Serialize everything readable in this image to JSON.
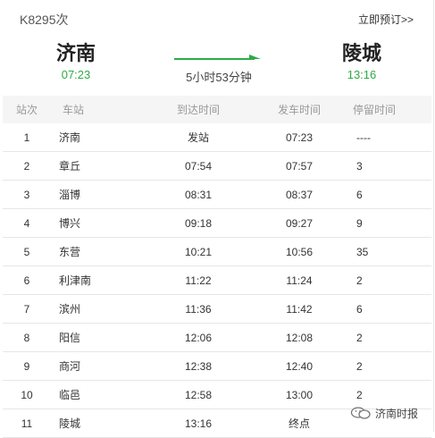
{
  "header": {
    "train_no": "K8295次",
    "book_link": "立即预订>>",
    "from_station": "济南",
    "from_time": "07:23",
    "to_station": "陵城",
    "to_time": "13:16",
    "duration": "5小时53分钟"
  },
  "table": {
    "columns": [
      "站次",
      "车站",
      "到达时间",
      "发车时间",
      "停留时间"
    ],
    "rows": [
      {
        "no": "1",
        "station": "济南",
        "arrive": "发站",
        "depart": "07:23",
        "stop": "----"
      },
      {
        "no": "2",
        "station": "章丘",
        "arrive": "07:54",
        "depart": "07:57",
        "stop": "3"
      },
      {
        "no": "3",
        "station": "淄博",
        "arrive": "08:31",
        "depart": "08:37",
        "stop": "6"
      },
      {
        "no": "4",
        "station": "博兴",
        "arrive": "09:18",
        "depart": "09:27",
        "stop": "9"
      },
      {
        "no": "5",
        "station": "东营",
        "arrive": "10:21",
        "depart": "10:56",
        "stop": "35"
      },
      {
        "no": "6",
        "station": "利津南",
        "arrive": "11:22",
        "depart": "11:24",
        "stop": "2"
      },
      {
        "no": "7",
        "station": "滨州",
        "arrive": "11:36",
        "depart": "11:42",
        "stop": "6"
      },
      {
        "no": "8",
        "station": "阳信",
        "arrive": "12:06",
        "depart": "12:08",
        "stop": "2"
      },
      {
        "no": "9",
        "station": "商河",
        "arrive": "12:38",
        "depart": "12:40",
        "stop": "2"
      },
      {
        "no": "10",
        "station": "临邑",
        "arrive": "12:58",
        "depart": "13:00",
        "stop": "2"
      },
      {
        "no": "11",
        "station": "陵城",
        "arrive": "13:16",
        "depart": "终点",
        "stop": ""
      }
    ]
  },
  "watermark": {
    "text": "济南时报",
    "icon": "wechat-icon"
  },
  "colors": {
    "accent_green": "#2eaa47",
    "header_bg": "#f5f5f5"
  }
}
